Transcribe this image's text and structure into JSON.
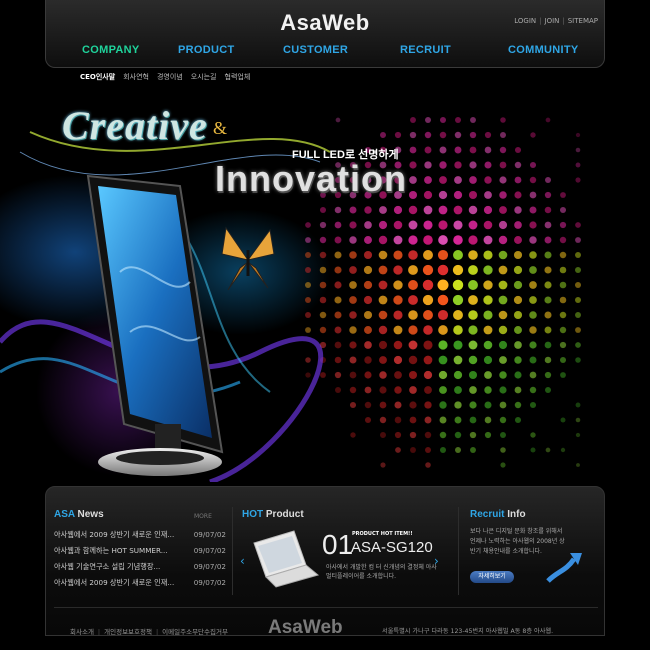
{
  "header": {
    "logo": "AsaWeb",
    "util": [
      "LOGIN",
      "JOIN",
      "SITEMAP"
    ],
    "gnb": [
      "COMPANY",
      "PRODUCT",
      "CUSTOMER",
      "RECRUIT",
      "COMMUNITY"
    ],
    "active_gnb": "COMPANY"
  },
  "subnav": [
    "CEO인사말",
    "회사연혁",
    "경영이념",
    "오시는길",
    "협력업체"
  ],
  "visual": {
    "title1": "Creative",
    "amp": "&",
    "subtitle": "FULL LED로 선명하게",
    "title2": "Innovation"
  },
  "news": {
    "title_a": "ASA",
    "title_b": " News",
    "more": "MORE",
    "items": [
      {
        "text": "아사웹에서 2009 상반기 새로운 인재...",
        "date": "09/07/02"
      },
      {
        "text": "아사웹과 함께하는 HOT SUMMER...",
        "date": "09/07/02"
      },
      {
        "text": "아사웹 기술연구소 설립 기념행장...",
        "date": "09/07/02"
      },
      {
        "text": "아사웹에서 2009 상반기 새로운 인재...",
        "date": "09/07/02"
      }
    ]
  },
  "hot": {
    "title_a": "HOT",
    "title_b": " Product",
    "num": "01",
    "tag": "PRODUCT HOT ITEM!!",
    "name": "ASA-SG120",
    "desc": "아사에서 개발한 컴 터 신개념의 결정체 아사 멀티플레이어를 소개합니다."
  },
  "recruit": {
    "title_a": "Recruit",
    "title_b": " Info",
    "desc": "보다 나은 디지털 문화 창조를 위해서 언제나 노력하는 아사웹의 2008년 상반기 채용안내를 소개합니다.",
    "button": "자세히보기"
  },
  "footer": {
    "links": [
      "회사소개",
      "개인정보보호정책",
      "이메일주소무단수집거부"
    ],
    "logo": "AsaWeb",
    "address": "서울특별시 가나구 다라동 123-45번지 아사웹빌 A동 8층 아사웹."
  },
  "colors": {
    "accent_blue": "#2fa6e6",
    "accent_green": "#1fd39b"
  }
}
